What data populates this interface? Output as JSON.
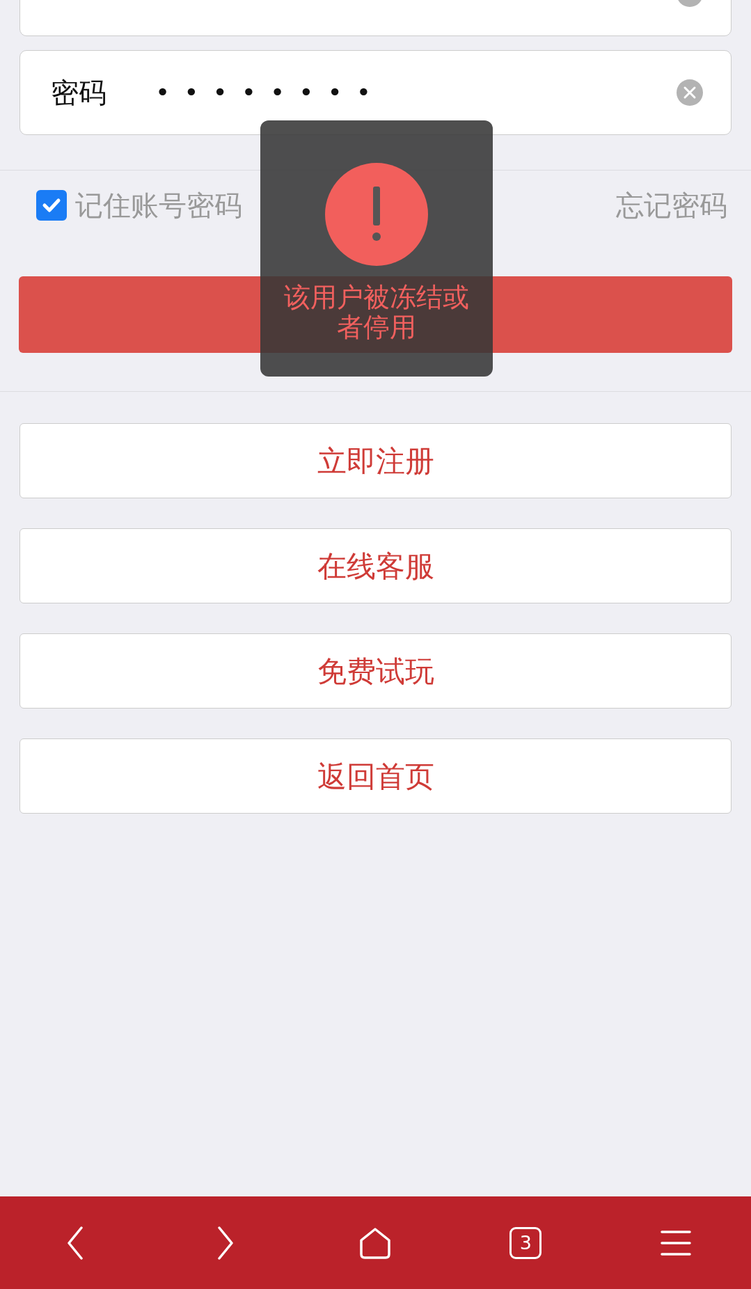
{
  "fields": [
    {
      "kind": "text"
    },
    {
      "kind": "password",
      "label": "密码",
      "value": "••••••••"
    }
  ],
  "remember": {
    "label": "记住账号密码",
    "checked": true
  },
  "forgot_link": "忘记密码",
  "buttons": [
    "立即注册",
    "在线客服",
    "免费试玩",
    "返回首页"
  ],
  "toast": {
    "message": "该用户被冻结或者停用"
  },
  "bottom_bar": {
    "tab_count": "3"
  }
}
